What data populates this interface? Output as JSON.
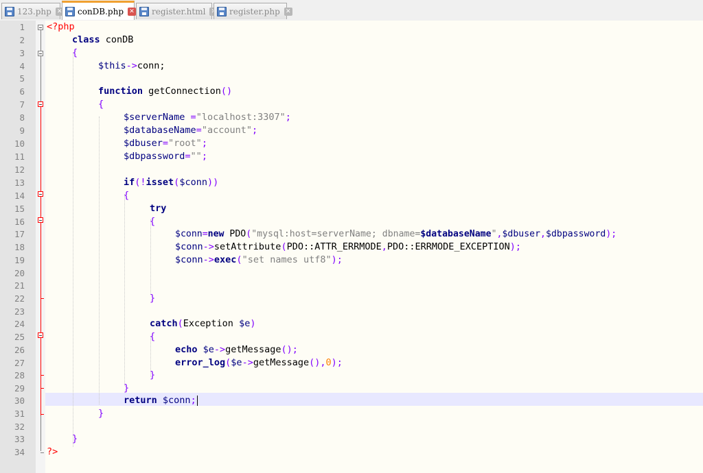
{
  "tabs": [
    {
      "label": "123.php",
      "active": false
    },
    {
      "label": "conDB.php",
      "active": true
    },
    {
      "label": "register.html",
      "active": false
    },
    {
      "label": "register.php",
      "active": false
    }
  ],
  "lines": [
    {
      "n": "1"
    },
    {
      "n": "2"
    },
    {
      "n": "3"
    },
    {
      "n": "4"
    },
    {
      "n": "5"
    },
    {
      "n": "6"
    },
    {
      "n": "7"
    },
    {
      "n": "8"
    },
    {
      "n": "9"
    },
    {
      "n": "10"
    },
    {
      "n": "11"
    },
    {
      "n": "12"
    },
    {
      "n": "13"
    },
    {
      "n": "14"
    },
    {
      "n": "15"
    },
    {
      "n": "16"
    },
    {
      "n": "17"
    },
    {
      "n": "18"
    },
    {
      "n": "19"
    },
    {
      "n": "20"
    },
    {
      "n": "21"
    },
    {
      "n": "22"
    },
    {
      "n": "23"
    },
    {
      "n": "24"
    },
    {
      "n": "25"
    },
    {
      "n": "26"
    },
    {
      "n": "27"
    },
    {
      "n": "28"
    },
    {
      "n": "29"
    },
    {
      "n": "30"
    },
    {
      "n": "31"
    },
    {
      "n": "32"
    },
    {
      "n": "33"
    },
    {
      "n": "34"
    }
  ],
  "code": {
    "l1": "<?php",
    "l2_kw": "class",
    "l2_name": " conDB",
    "l3": "{",
    "l4_var": "$this",
    "l4_op": "->",
    "l4_rest": "conn;",
    "l6_kw": "function",
    "l6_name": " getConnection",
    "l6_paren": "()",
    "l7": "{",
    "l8_var": "$serverName ",
    "l8_op": "=",
    "l8_str": "\"localhost:3307\"",
    "l8_end": ";",
    "l9_var": "$databaseName",
    "l9_op": "=",
    "l9_str": "\"account\"",
    "l9_end": ";",
    "l10_var": "$dbuser",
    "l10_op": "=",
    "l10_str": "\"root\"",
    "l10_end": ";",
    "l11_var": "$dbpassword",
    "l11_op": "=",
    "l11_str": "\"\"",
    "l11_end": ";",
    "l13_kw": "if",
    "l13_op1": "(!",
    "l13_kw2": "isset",
    "l13_op2": "(",
    "l13_var": "$conn",
    "l13_op3": "))",
    "l14": "{",
    "l15_kw": "try",
    "l16": "{",
    "l17_var": "$conn",
    "l17_op": "=",
    "l17_kw": "new",
    "l17_cls": " PDO",
    "l17_op2": "(",
    "l17_str1": "\"mysql:host=serverName; dbname=",
    "l17_strvar": "$databaseName",
    "l17_str2": "\"",
    "l17_op3": ",",
    "l17_var2": "$dbuser",
    "l17_op4": ",",
    "l17_var3": "$dbpassword",
    "l17_op5": ");",
    "l18_var": "$conn",
    "l18_op": "->",
    "l18_fn": "setAttribute",
    "l18_op2": "(",
    "l18_c1": "PDO::ATTR_ERRMODE",
    "l18_op3": ",",
    "l18_c2": "PDO::ERRMODE_EXCEPTION",
    "l18_op4": ");",
    "l19_var": "$conn",
    "l19_op": "->",
    "l19_kw": "exec",
    "l19_op2": "(",
    "l19_str": "\"set names utf8\"",
    "l19_op3": ");",
    "l22": "}",
    "l24_kw": "catch",
    "l24_op": "(",
    "l24_cls": "Exception ",
    "l24_var": "$e",
    "l24_op2": ")",
    "l25": "{",
    "l26_kw": "echo",
    "l26_var": " $e",
    "l26_op": "->",
    "l26_fn": "getMessage",
    "l26_op2": "();",
    "l27_kw": "error_log",
    "l27_op": "(",
    "l27_var": "$e",
    "l27_op2": "->",
    "l27_fn": "getMessage",
    "l27_op3": "(),",
    "l27_num": "0",
    "l27_op4": ");",
    "l28": "}",
    "l29": "}",
    "l30_kw": "return",
    "l30_var": " $conn",
    "l30_op": ";",
    "l31": "}",
    "l33": "}",
    "l34": "?>"
  }
}
